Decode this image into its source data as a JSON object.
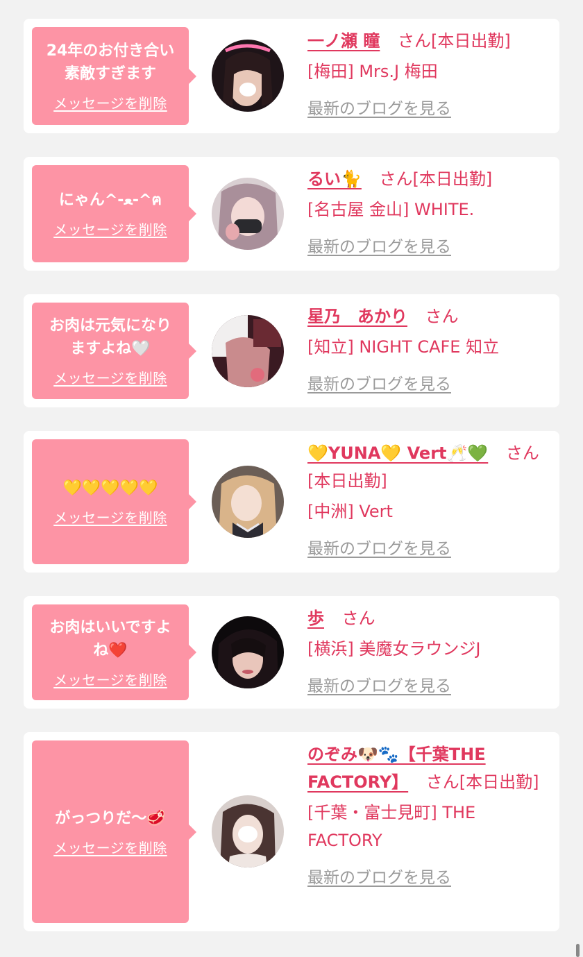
{
  "delete_label": "メッセージを削除",
  "blog_label": "最新のブログを見る",
  "san_label": "さん",
  "cards": [
    {
      "message": "24年のお付き合い\n素敵すぎます",
      "name": "一ノ瀬 瞳",
      "status": "さん[本日出勤]",
      "shop": "[梅田] Mrs.J 梅田"
    },
    {
      "message": "にゃん^-ﻌ-^ฅ",
      "name": "るい🐈",
      "status": "さん[本日出勤]",
      "shop": "[名古屋 金山] WHITE."
    },
    {
      "message": "お肉は元気になり\nますよね🤍",
      "name": "星乃　あかり",
      "status": "さん",
      "shop": "[知立] NIGHT CAFE 知立"
    },
    {
      "message": "💛💛💛💛💛",
      "name": "💛YUNA💛 Vert🥂💚",
      "status": "さん[本日出勤]",
      "shop": "[中洲] Vert"
    },
    {
      "message": "お肉はいいですよ\nね❤️",
      "name": "歩",
      "status": "さん",
      "shop": "[横浜] 美魔女ラウンジJ"
    },
    {
      "message": "がっつりだ〜🥩",
      "name": "のぞみ🐶🐾【千葉THE FACTORY】",
      "status": "さん[本日出勤]",
      "shop": "[千葉・富士見町] THE FACTORY"
    }
  ]
}
